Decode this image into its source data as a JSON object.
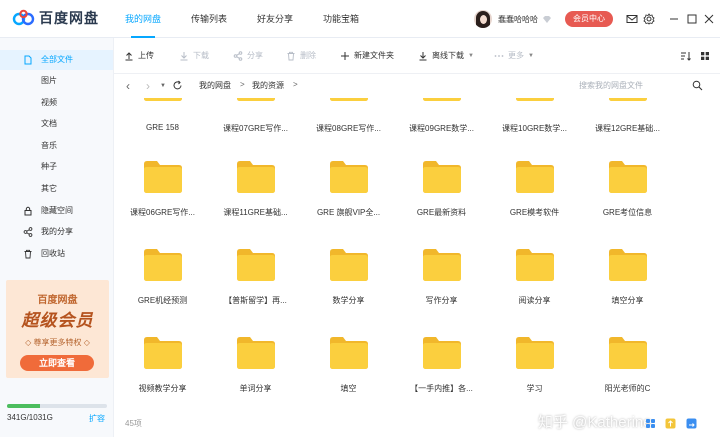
{
  "app": {
    "logo_text": "百度网盘",
    "brand_color": "#06a7ff"
  },
  "nav": [
    {
      "label": "我的网盘",
      "active": true
    },
    {
      "label": "传输列表",
      "active": false
    },
    {
      "label": "好友分享",
      "active": false
    },
    {
      "label": "功能宝箱",
      "active": false
    }
  ],
  "user": {
    "name": "蠢蠢哈哈哈",
    "vip_button": "会员中心"
  },
  "sidebar": {
    "items": [
      {
        "label": "全部文件",
        "icon": "document-icon",
        "active": true
      },
      {
        "label": "图片",
        "icon": "",
        "active": false
      },
      {
        "label": "视频",
        "icon": "",
        "active": false
      },
      {
        "label": "文档",
        "icon": "",
        "active": false
      },
      {
        "label": "音乐",
        "icon": "",
        "active": false
      },
      {
        "label": "种子",
        "icon": "",
        "active": false
      },
      {
        "label": "其它",
        "icon": "",
        "active": false
      },
      {
        "label": "隐藏空间",
        "icon": "lock-icon",
        "active": false
      },
      {
        "label": "我的分享",
        "icon": "share-icon",
        "active": false
      },
      {
        "label": "回收站",
        "icon": "trash-icon",
        "active": false
      }
    ],
    "promo": {
      "title": "百度网盘",
      "slogan": "超级会员",
      "sub": "◇ 尊享更多特权 ◇",
      "button": "立即查看"
    },
    "quota": {
      "text": "341G/1031G",
      "expand": "扩容",
      "used_ratio": 0.33
    }
  },
  "toolbar": {
    "upload": "上传",
    "download": "下载",
    "share": "分享",
    "delete": "删除",
    "new_folder": "新建文件夹",
    "offline_download": "离线下载",
    "more": "更多"
  },
  "address": {
    "crumbs": [
      "我的网盘",
      "我的资源"
    ],
    "search_placeholder": "搜索我的网盘文件"
  },
  "files": [
    "GRE 158",
    "课程07GRE写作...",
    "课程08GRE写作...",
    "课程09GRE数学...",
    "课程10GRE数学...",
    "课程12GRE基础...",
    "课程06GRE写作...",
    "课程11GRE基础...",
    "GRE 旗舰VIP全...",
    "GRE最新资料",
    "GRE模考软件",
    "GRE考位信息",
    "GRE机经预测",
    "【普斯留学】再...",
    "数学分享",
    "写作分享",
    "阅读分享",
    "填空分享",
    "视频教学分享",
    "单词分享",
    "填空",
    "【一手内推】各...",
    "学习",
    "阳光老师的C"
  ],
  "status": {
    "count": "45项",
    "watermark": "知乎 @Katherine"
  }
}
